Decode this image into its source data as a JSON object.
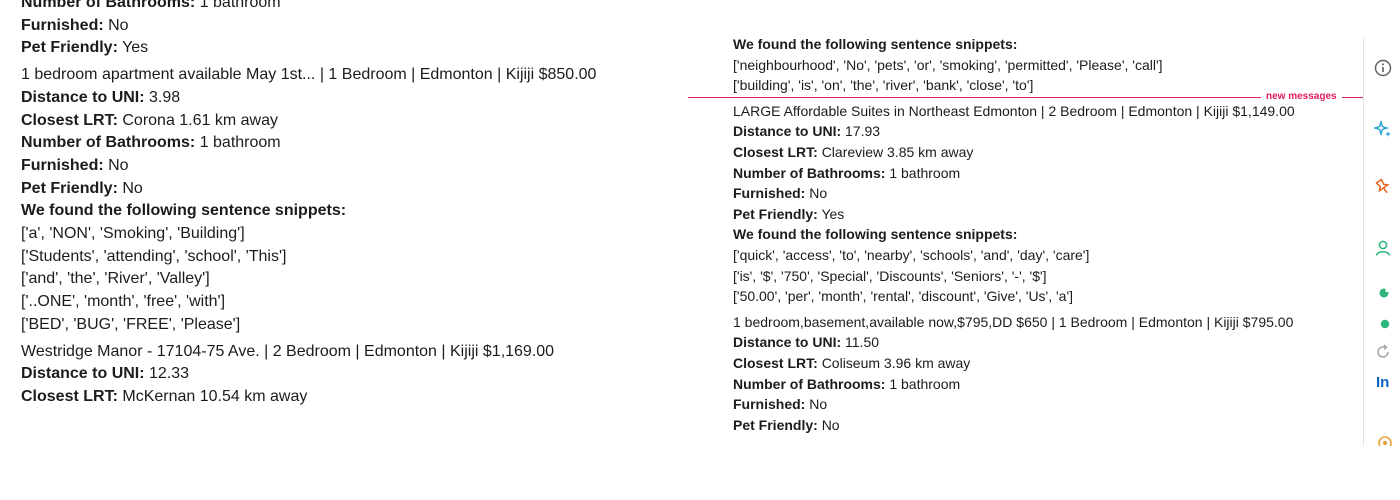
{
  "labels": {
    "distance": "Distance to UNI:",
    "lrt": "Closest LRT:",
    "bathrooms": "Number of Bathrooms:",
    "furnished": "Furnished:",
    "pet": "Pet Friendly:",
    "snippets": "We found the following sentence snippets:"
  },
  "left": {
    "partial": {
      "bathrooms_label": "Number of Bathrooms:",
      "bathrooms": "1 bathroom",
      "furnished": "No",
      "pet": "Yes"
    },
    "listing1": {
      "title": "1 bedroom apartment available May 1st... | 1 Bedroom | Edmonton | Kijiji $850.00",
      "distance": "3.98",
      "lrt": "Corona 1.61 km away",
      "bathrooms": "1 bathroom",
      "furnished": "No",
      "pet": "No",
      "snippets": [
        "['a', 'NON', 'Smoking', 'Building']",
        "['Students', 'attending', 'school', 'This']",
        "['and', 'the', 'River', 'Valley']",
        "['..ONE', 'month', 'free', 'with']",
        "['BED', 'BUG', 'FREE', 'Please']"
      ]
    },
    "listing2": {
      "title": "Westridge Manor - 17104-75 Ave. | 2 Bedroom | Edmonton | Kijiji $1,169.00",
      "distance": "12.33",
      "lrt": "McKernan 10.54 km away"
    }
  },
  "right": {
    "partial": {
      "snippets": [
        "['neighbourhood', 'No', 'pets', 'or', 'smoking', 'permitted', 'Please', 'call']",
        "['building', 'is', 'on', 'the', 'river', 'bank', 'close', 'to']"
      ]
    },
    "divider_label": "new messages",
    "listing1": {
      "title": "LARGE Affordable Suites in Northeast Edmonton | 2 Bedroom | Edmonton | Kijiji $1,149.00",
      "distance": "17.93",
      "lrt": "Clareview 3.85 km away",
      "bathrooms": "1 bathroom",
      "furnished": "No",
      "pet": "Yes",
      "snippets": [
        "['quick', 'access', 'to', 'nearby', 'schools', 'and', 'day', 'care']",
        "['is', '$', '750', 'Special', 'Discounts', 'Seniors', '-', '$']",
        "['50.00', 'per', 'month', 'rental', 'discount', 'Give', 'Us', 'a']"
      ]
    },
    "listing2": {
      "title": "1 bedroom,basement,available now,$795,DD $650 | 1 Bedroom | Edmonton | Kijiji $795.00",
      "distance": "11.50",
      "lrt": "Coliseum 3.96 km away",
      "bathrooms": "1 bathroom",
      "furnished": "No",
      "pet": "No"
    }
  },
  "sidebar": {
    "icons": [
      "info-icon",
      "sparkle-icon",
      "pin-icon",
      "person-icon",
      "status-icon",
      "dot-icon",
      "refresh-icon",
      "linkedin-icon",
      "settings-icon"
    ],
    "linkedin_text": "In"
  },
  "colors": {
    "divider": "#e01e5a",
    "text": "#1d1c1d",
    "sparkle": "#1d9bd1",
    "pin": "#e8590c",
    "person": "#2eb67d",
    "linkedin": "#0a66c2"
  }
}
